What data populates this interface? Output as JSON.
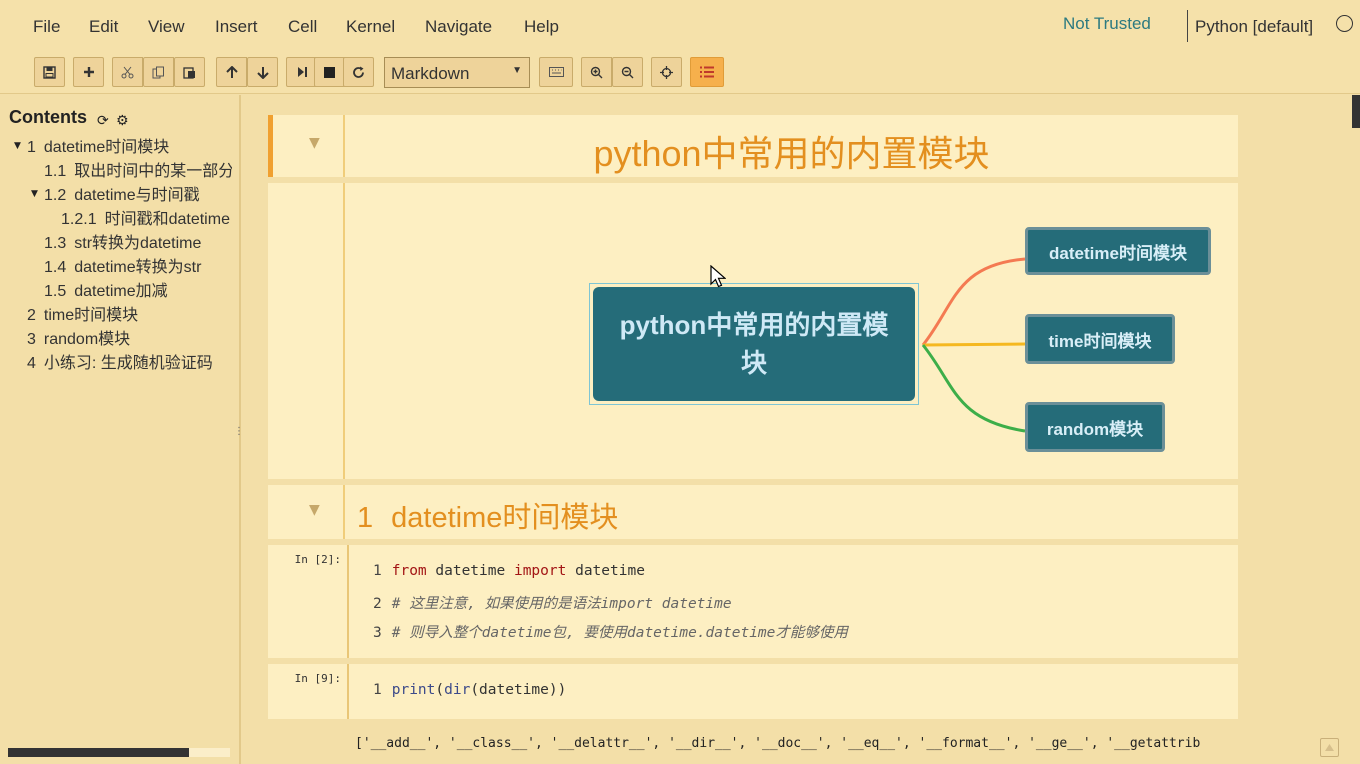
{
  "menu": [
    "File",
    "Edit",
    "View",
    "Insert",
    "Cell",
    "Kernel",
    "Navigate",
    "Help"
  ],
  "trust_status": "Not Trusted",
  "kernel_name": "Python [default]",
  "toolbar": {
    "cell_type": "Markdown",
    "icons": [
      "save-icon",
      "plus-icon",
      "cut-icon",
      "copy-icon",
      "paste-icon",
      "arrow-up-icon",
      "arrow-down-icon",
      "step-forward-icon",
      "stop-icon",
      "refresh-icon",
      "keyboard-icon",
      "zoom-in-icon",
      "zoom-out-icon",
      "crosshair-icon",
      "toc-list-icon"
    ]
  },
  "toc": {
    "title": "Contents",
    "items": [
      {
        "num": "1",
        "label": "datetime时间模块"
      },
      {
        "num": "1.1",
        "label": "取出时间中的某一部分"
      },
      {
        "num": "1.2",
        "label": "datetime与时间戳"
      },
      {
        "num": "1.2.1",
        "label": "时间戳和datetime"
      },
      {
        "num": "1.3",
        "label": "str转换为datetime"
      },
      {
        "num": "1.4",
        "label": "datetime转换为str"
      },
      {
        "num": "1.5",
        "label": "datetime加减"
      },
      {
        "num": "2",
        "label": "time时间模块"
      },
      {
        "num": "3",
        "label": "random模块"
      },
      {
        "num": "4",
        "label": "小练习: 生成随机验证码"
      }
    ]
  },
  "cells": {
    "title": "python中常用的内置模块",
    "mindmap": {
      "root": "python中常用的内置模块",
      "children": [
        "datetime时间模块",
        "time时间模块",
        "random模块"
      ],
      "branch_colors": [
        "#f47a52",
        "#f5b820",
        "#3dae49"
      ]
    },
    "heading": {
      "num": "1",
      "text": "datetime时间模块"
    },
    "code1": {
      "prompt": "In [2]:",
      "lines": [
        {
          "n": "1",
          "kw1": "from",
          "a": " datetime ",
          "kw2": "import",
          "b": " datetime"
        },
        {
          "n": "2",
          "comment": "# 这里注意, 如果使用的是语法import datetime"
        },
        {
          "n": "3",
          "comment": "# 则导入整个datetime包, 要使用datetime.datetime才能够使用"
        }
      ]
    },
    "code2": {
      "prompt": "In [9]:",
      "line": {
        "n": "1",
        "fn": "print",
        "p1": "(",
        "fn2": "dir",
        "rest": "(datetime))"
      }
    },
    "output": "['__add__', '__class__', '__delattr__', '__dir__', '__doc__', '__eq__', '__format__', '__ge__', '__getattrib"
  }
}
